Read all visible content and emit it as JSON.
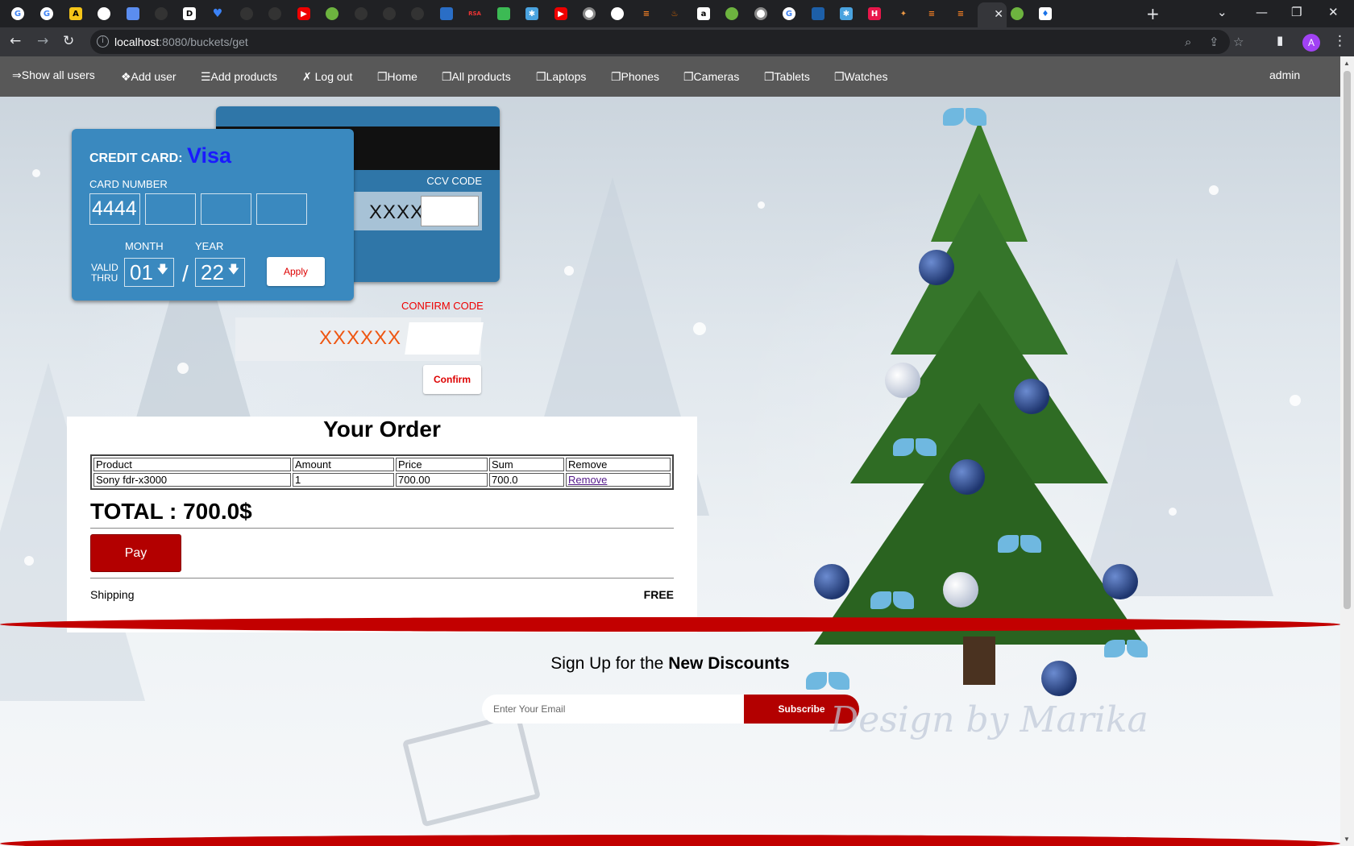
{
  "browser": {
    "tab_count_favicons": [
      "google",
      "google",
      "pluralsight",
      "circle",
      "chart",
      "github",
      "dev",
      "heart",
      "github",
      "github",
      "youtube",
      "spring",
      "github",
      "github",
      "github",
      "bookmark",
      "rsa",
      "chart",
      "snow",
      "youtube",
      "chrome",
      "circle",
      "stackoverflow",
      "java",
      "letter",
      "spring",
      "chrome",
      "google",
      "flag",
      "snow",
      "red",
      "fire",
      "stackoverflow",
      "stackoverflow",
      "active",
      "spring",
      "drop"
    ],
    "address": {
      "host": "localhost",
      "rest": ":8080/buckets/get"
    },
    "profile_initial": "A"
  },
  "nav": {
    "show_all_users": "⇒Show all users",
    "add_user": "❖Add user",
    "add_products": "☰Add products",
    "log_out": "✗ Log out",
    "home": "❐Home",
    "all_products": "❐All products",
    "laptops": "❐Laptops",
    "phones": "❐Phones",
    "cameras": "❐Cameras",
    "tablets": "❐Tablets",
    "watches": "❐Watches",
    "user": "admin"
  },
  "card": {
    "title": "CREDIT CARD:",
    "brand": "Visa",
    "number_label": "CARD NUMBER",
    "number_parts": [
      "4444",
      "",
      "",
      ""
    ],
    "month_label": "MONTH",
    "year_label": "YEAR",
    "valid": "VALID",
    "thru": "THRU",
    "month": "01",
    "year": "22",
    "separator": "/",
    "apply": "Apply",
    "ccv_label": "CCV CODE",
    "ccv_mask": "XXXX"
  },
  "confirm": {
    "label": "CONFIRM CODE",
    "mask": "XXXXXX",
    "button": "Confirm"
  },
  "order": {
    "title": "Your Order",
    "columns": [
      "Product",
      "Amount",
      "Price",
      "Sum",
      "Remove"
    ],
    "rows": [
      {
        "product": "Sony fdr-x3000",
        "amount": "1",
        "price": "700.00",
        "sum": "700.0",
        "remove": "Remove"
      }
    ],
    "total": "TOTAL : 700.0$",
    "pay": "Pay",
    "shipping_label": "Shipping",
    "shipping_value": "FREE"
  },
  "newsletter": {
    "title_plain": "Sign Up for the ",
    "title_bold": "New Discounts",
    "email_placeholder": "Enter Your Email",
    "subscribe": "Subscribe"
  },
  "watermark": "Design by Marika",
  "colors": {
    "nav_bg": "#585858",
    "card_front": "#3a89bf",
    "card_back": "#2f76a8",
    "brand_text": "#1a1aff",
    "accent_red": "#b30000"
  }
}
